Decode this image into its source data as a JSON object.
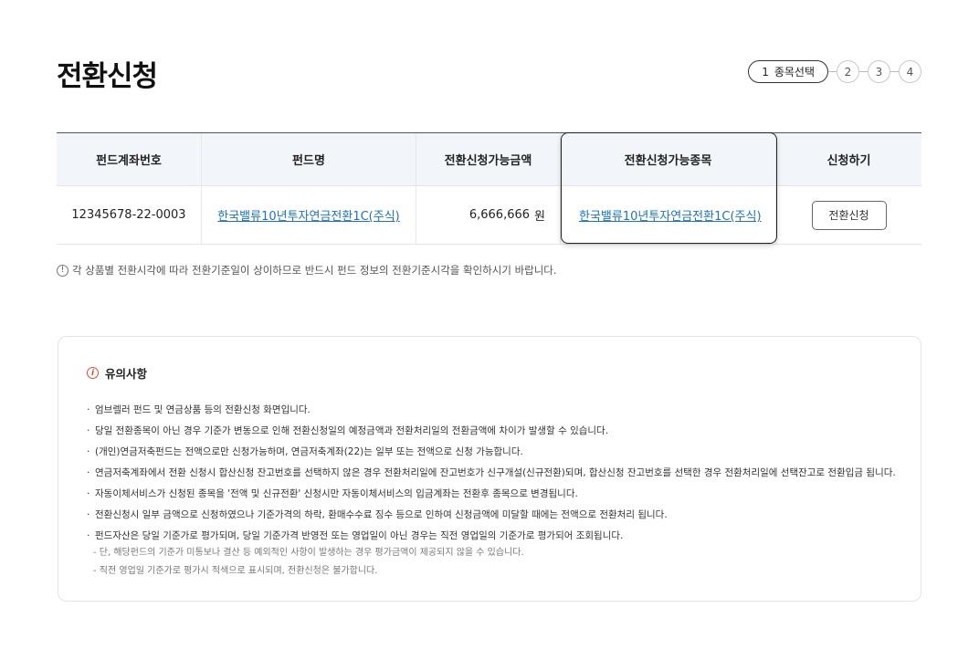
{
  "page": {
    "title": "전환신청"
  },
  "stepper": {
    "active": {
      "number": "1",
      "label": "종목선택"
    },
    "steps": [
      "2",
      "3",
      "4"
    ]
  },
  "table": {
    "headers": [
      "펀드계좌번호",
      "펀드명",
      "전환신청가능금액",
      "전환신청가능종목",
      "신청하기"
    ],
    "row": {
      "account": "12345678-22-0003",
      "fund_name": "한국밸류10년투자연금전환1C(주식)",
      "amount": "6,666,666",
      "amount_unit": "원",
      "target_fund": "한국밸류10년투자연금전환1C(주식)",
      "apply_label": "전환신청"
    }
  },
  "note": {
    "icon": "!",
    "text": "각 상품별 전환시각에 따라 전환기준일이 상이하므로 반드시 펀드 정보의 전환기준시각을 확인하시기 바랍니다."
  },
  "notice": {
    "title": "유의사항",
    "icon": "i",
    "items": [
      "엄브렐러 펀드 및 연금상품 등의 전환신청 화면입니다.",
      "당일 전환종목이 아닌 경우 기준가 변동으로 인해 전환신청일의 예정금액과 전환처리일의 전환금액에 차이가 발생할 수 있습니다.",
      "(개인)연금저축펀드는 전액으로만 신청가능하며, 연금저축계좌(22)는 일부 또는 전액으로 신청 가능합니다.",
      "연금저축계좌에서 전환 신청시 합산신청 잔고번호를 선택하지 않은 경우 전환처리일에 잔고번호가 신구개설(신규전환)되며, 합산신청 잔고번호를 선택한 경우 전환처리일에 선택잔고로 전환입금 됩니다.",
      "자동이체서비스가 신청된 종목을 '전액 및 신규전환' 신청시만 자동이체서비스의 입금계좌는 전환후 종목으로 변경됩니다.",
      "전환신청시 일부 금액으로 신청하였으나 기준가격의 하락, 환매수수료 징수 등으로 인하여 신청금액에 미달할 때에는 전액으로 전환처리 됩니다.",
      "펀드자산은 당일 기준가로 평가되며, 당일 기준가격 반영전 또는 영업일이 아닌 경우는 직전 영업일의 기준가로 평가되어 조회됩니다."
    ],
    "sub_items": [
      "- 단, 해당펀드의 기준가 미통보나 결산 등 예외적인 사항이 발생하는 경우 평가금액이 제공되지 않을 수 있습니다.",
      "- 직전 영업일 기준가로 평가시 적색으로 표시되며, 전환신청은 불가합니다."
    ]
  }
}
